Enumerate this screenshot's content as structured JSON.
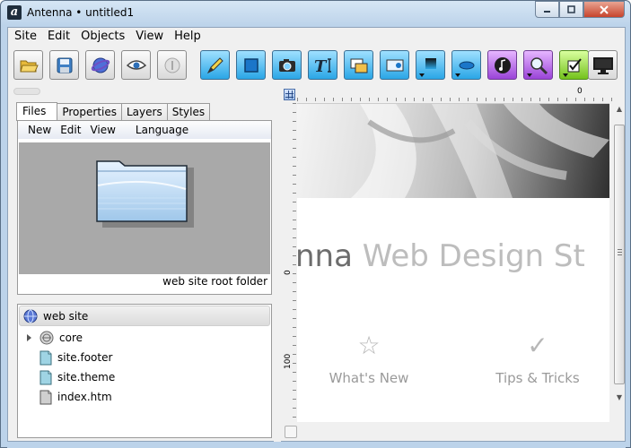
{
  "window": {
    "title": "Antenna • untitled1",
    "logo_letter": "a"
  },
  "menubar": {
    "items": [
      "Site",
      "Edit",
      "Objects",
      "View",
      "Help"
    ]
  },
  "toolbar": {
    "buttons": [
      {
        "name": "open-folder",
        "icon": "folder-icon"
      },
      {
        "name": "save",
        "icon": "floppy-icon"
      },
      {
        "name": "preview-browser",
        "icon": "globe-icon"
      },
      {
        "name": "preview-eye",
        "icon": "eye-icon"
      },
      {
        "name": "info",
        "icon": "info-icon"
      },
      {
        "name": "pen-tool",
        "icon": "pen-icon"
      },
      {
        "name": "box",
        "icon": "rectangle-icon"
      },
      {
        "name": "image",
        "icon": "camera-icon"
      },
      {
        "name": "text",
        "icon": "text-icon"
      },
      {
        "name": "gallery",
        "icon": "gallery-icon"
      },
      {
        "name": "media",
        "icon": "media-icon"
      },
      {
        "name": "gradient",
        "icon": "gradient-icon"
      },
      {
        "name": "shape",
        "icon": "ellipse-icon"
      },
      {
        "name": "audio",
        "icon": "music-icon"
      },
      {
        "name": "search",
        "icon": "search-icon"
      },
      {
        "name": "form",
        "icon": "checkbox-icon"
      },
      {
        "name": "screen",
        "icon": "monitor-icon"
      }
    ]
  },
  "left_panel": {
    "tabs": [
      "Files",
      "Properties",
      "Layers",
      "Styles"
    ],
    "active_tab": "Files",
    "files_menu": [
      "New",
      "Edit",
      "View",
      "Language"
    ],
    "preview_caption": "web site root folder",
    "tree": {
      "root": "web site",
      "items": [
        {
          "label": "core",
          "icon": "disc-icon",
          "expandable": true
        },
        {
          "label": "site.footer",
          "icon": "page-icon-teal"
        },
        {
          "label": "site.theme",
          "icon": "page-icon-teal"
        },
        {
          "label": "index.htm",
          "icon": "page-icon-grey"
        }
      ]
    }
  },
  "canvas": {
    "h_ruler_label": "0",
    "v_ruler_labels": [
      "0",
      "100"
    ],
    "headline_dark": "nna",
    "headline_light": " Web Design St",
    "features": [
      {
        "glyph": "☆",
        "label": "What's New"
      },
      {
        "glyph": "✓",
        "label": "Tips & Tricks"
      }
    ]
  },
  "colors": {
    "accent_blue": "#2aa6e6",
    "accent_purple": "#9a44d8",
    "accent_green": "#74c21c",
    "close_red": "#c7442c"
  }
}
